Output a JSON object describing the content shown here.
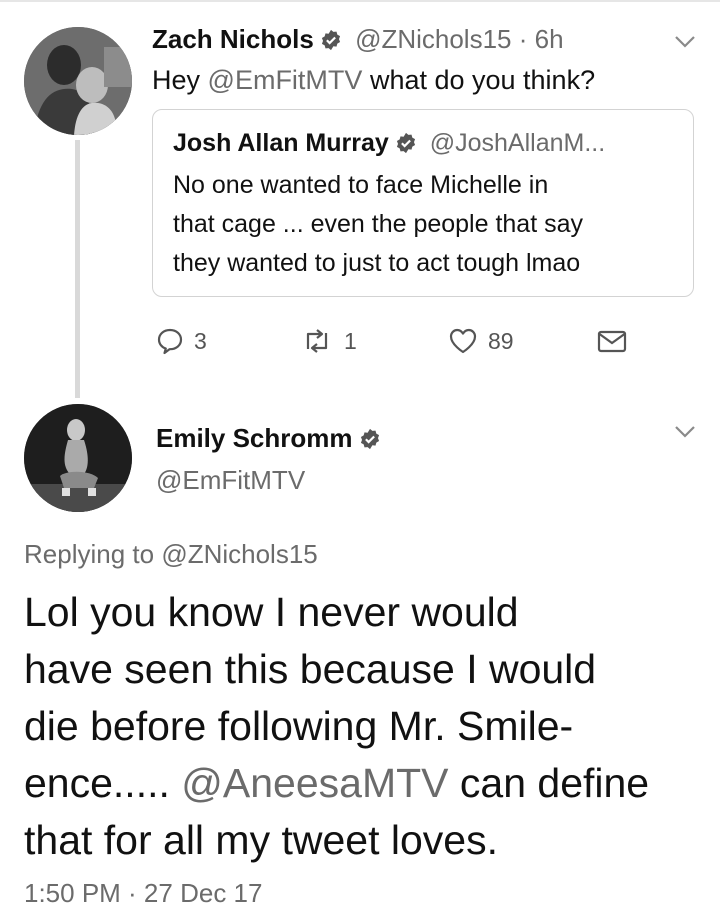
{
  "tweet1": {
    "author_name": "Zach Nichols",
    "author_handle": "@ZNichols15",
    "time_sep": "·",
    "time_ago": "6h",
    "text_prefix": "Hey ",
    "text_mention": "@EmFitMTV",
    "text_suffix": " what do you think?",
    "avatar_icon": "person-holding-baby-avatar",
    "quote": {
      "author_name": "Josh Allan Murray",
      "author_handle": "@JoshAllanM...",
      "lines": [
        "No one wanted to face Michelle in",
        "that cage ... even the people that say",
        "they wanted to just to act tough lmao"
      ]
    },
    "actions": {
      "reply_count": "3",
      "retweet_count": "1",
      "like_count": "89"
    }
  },
  "tweet2": {
    "author_name": "Emily Schromm",
    "author_handle": "@EmFitMTV",
    "avatar_icon": "person-squatting-avatar",
    "replying_prefix": "Replying to ",
    "replying_handle": "@ZNichols15",
    "body": {
      "line1": "Lol you know I never would",
      "line2": "have seen this because I would",
      "line3": "die before following Mr. Smile-",
      "line4_prefix": "ence..... ",
      "line4_mention": "@AneesaMTV",
      "line4_suffix": " can define",
      "line5": "that for all my tweet loves."
    },
    "timestamp": "1:50 PM · 27 Dec 17"
  },
  "colors": {
    "text": "#111111",
    "muted": "#6b6b6b",
    "border": "#d3d3d3",
    "thread_line": "#d9d9d9"
  }
}
